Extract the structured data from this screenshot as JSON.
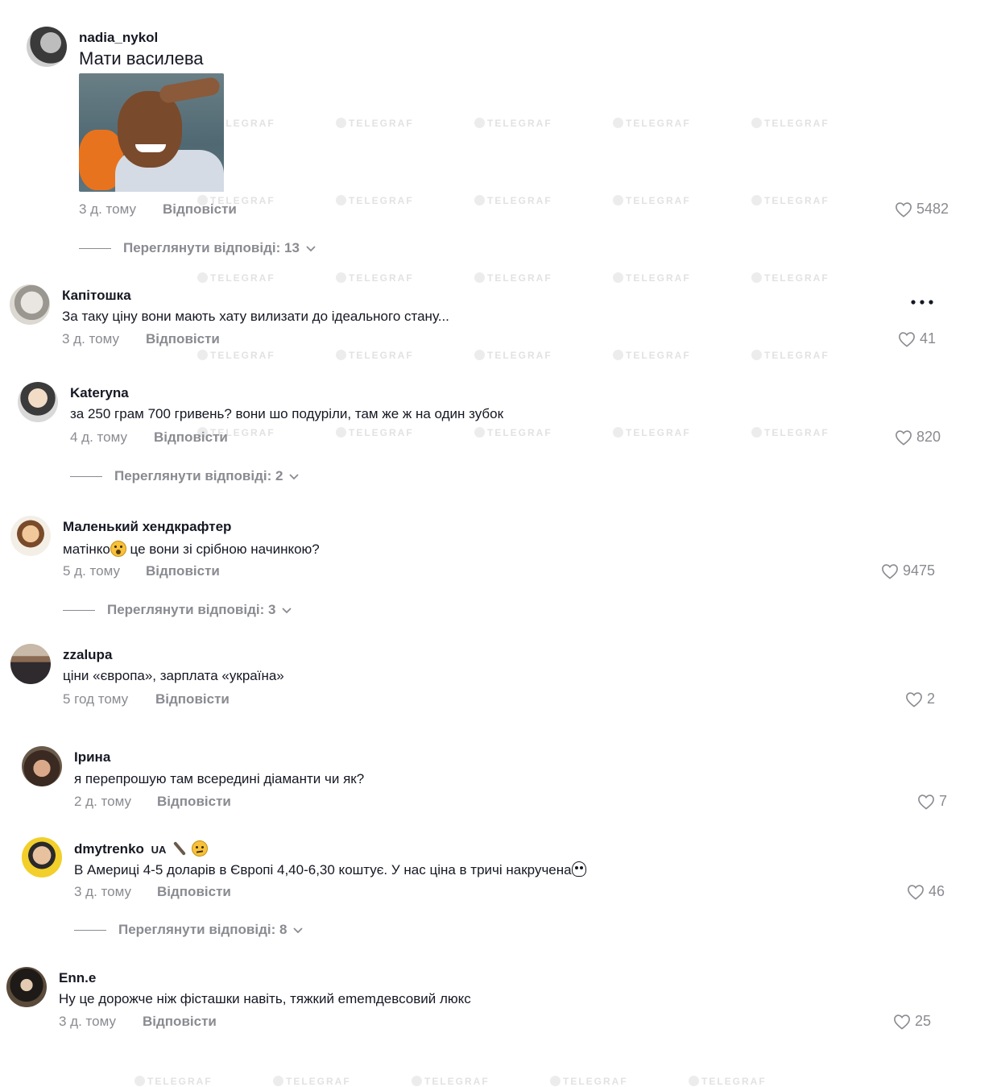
{
  "watermark": "TELEGRAF",
  "reply_label": "Відповісти",
  "comments": [
    {
      "username": "nadia_nykol",
      "text": "Мати василева",
      "time": "3 д. тому",
      "likes": "5482",
      "view_replies": "Переглянути відповіді: 13"
    },
    {
      "username": "Капітошка",
      "text": "За таку ціну вони мають хату вилизати до ідеального стану...",
      "time": "3 д. тому",
      "likes": "41"
    },
    {
      "username": "Kateryna",
      "text": "за 250 грам 700 гривень? вони шо подуріли, там же ж на один зубок",
      "time": "4 д. тому",
      "likes": "820",
      "view_replies": "Переглянути відповіді: 2"
    },
    {
      "username": "Маленький хендкрафтер",
      "text_before": "матінко",
      "text_after": " це вони зі срібною начинкою?",
      "emoji": "hushed-face",
      "time": "5 д. тому",
      "likes": "9475",
      "view_replies": "Переглянути відповіді: 3"
    },
    {
      "username": "zzalupa",
      "text": "ціни «європа», зарплата «україна»",
      "time": "5 год тому",
      "likes": "2"
    },
    {
      "username": "Ірина",
      "text": "я перепрошую там всередині діаманти чи як?",
      "time": "2 д. тому",
      "likes": "7"
    },
    {
      "username": "dmytrenko",
      "badge": "UA",
      "text": "В Америці 4-5 доларів в Європі 4,40-6,30 коштує. У нас ціна в тричі накручена",
      "emojis": [
        "feather",
        "confused-face",
        "skull"
      ],
      "time": "3 д. тому",
      "likes": "46",
      "view_replies": "Переглянути відповіді: 8"
    },
    {
      "username": "Enn.e",
      "text": "Ну це дорожче ніж фісташки навіть, тяжкий ememдевсовий люкс",
      "time": "3 д. тому",
      "likes": "25"
    }
  ],
  "colors": {
    "text": "#161823",
    "muted": "#8a8b91",
    "watermark": "#e2e2e2"
  }
}
